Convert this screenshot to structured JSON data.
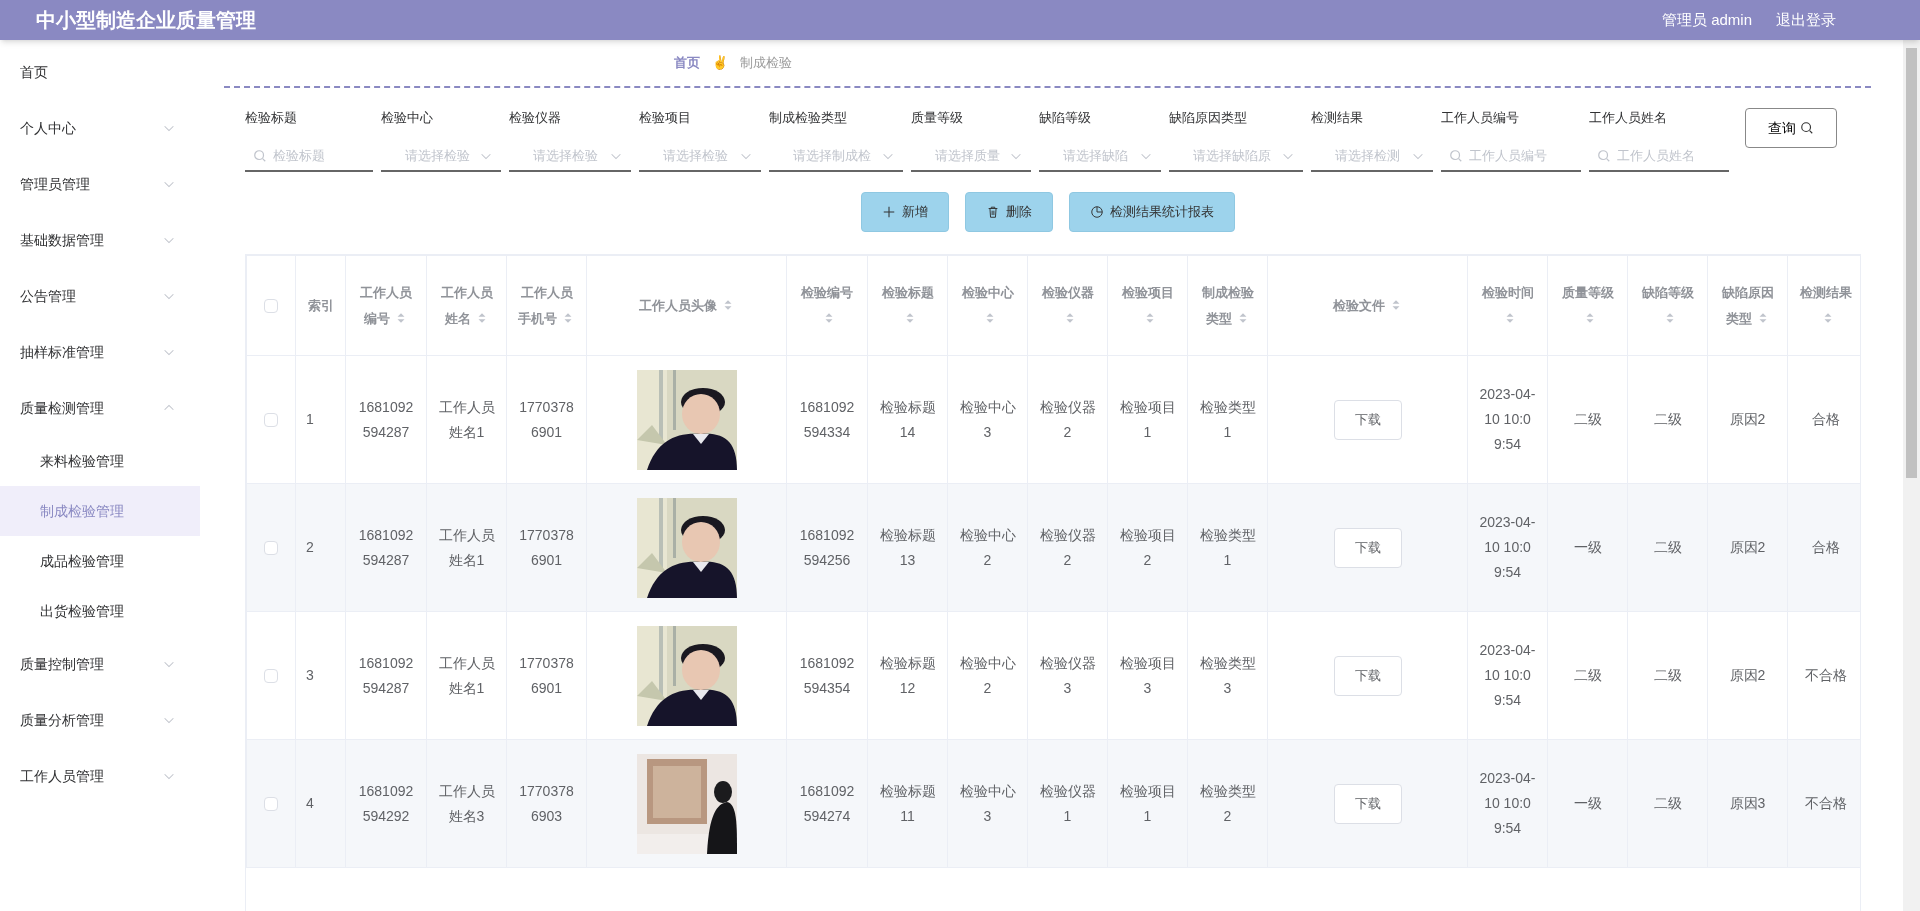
{
  "header": {
    "title": "中小型制造企业质量管理",
    "user": "管理员 admin",
    "logout": "退出登录"
  },
  "sidebar": {
    "items": [
      {
        "label": "首页",
        "kind": "link",
        "selected": false
      },
      {
        "label": "个人中心",
        "kind": "menu",
        "expanded": false,
        "selected": false
      },
      {
        "label": "管理员管理",
        "kind": "menu",
        "expanded": false,
        "selected": false
      },
      {
        "label": "基础数据管理",
        "kind": "menu",
        "expanded": false,
        "selected": false
      },
      {
        "label": "公告管理",
        "kind": "menu",
        "expanded": false,
        "selected": false
      },
      {
        "label": "抽样标准管理",
        "kind": "menu",
        "expanded": false,
        "selected": false
      },
      {
        "label": "质量检测管理",
        "kind": "menu",
        "expanded": true,
        "selected": false,
        "children": [
          {
            "label": "来料检验管理",
            "selected": false
          },
          {
            "label": "制成检验管理",
            "selected": true
          },
          {
            "label": "成品检验管理",
            "selected": false
          },
          {
            "label": "出货检验管理",
            "selected": false
          }
        ]
      },
      {
        "label": "质量控制管理",
        "kind": "menu",
        "expanded": false,
        "selected": false
      },
      {
        "label": "质量分析管理",
        "kind": "menu",
        "expanded": false,
        "selected": false
      },
      {
        "label": "工作人员管理",
        "kind": "menu",
        "expanded": false,
        "selected": false
      }
    ]
  },
  "breadcrumb": {
    "home": "首页",
    "separator": "✌",
    "current": "制成检验"
  },
  "filters": [
    {
      "label": "检验标题",
      "kind": "search",
      "placeholder": "检验标题"
    },
    {
      "label": "检验中心",
      "kind": "select",
      "placeholder": "请选择检验"
    },
    {
      "label": "检验仪器",
      "kind": "select",
      "placeholder": "请选择检验"
    },
    {
      "label": "检验项目",
      "kind": "select",
      "placeholder": "请选择检验"
    },
    {
      "label": "制成检验类型",
      "kind": "select",
      "placeholder": "请选择制成检"
    },
    {
      "label": "质量等级",
      "kind": "select",
      "placeholder": "请选择质量"
    },
    {
      "label": "缺陷等级",
      "kind": "select",
      "placeholder": "请选择缺陷"
    },
    {
      "label": "缺陷原因类型",
      "kind": "select",
      "placeholder": "请选择缺陷原"
    },
    {
      "label": "检测结果",
      "kind": "select",
      "placeholder": "请选择检测"
    },
    {
      "label": "工作人员编号",
      "kind": "search",
      "placeholder": "工作人员编号"
    },
    {
      "label": "工作人员姓名",
      "kind": "search",
      "placeholder": "工作人员姓名"
    }
  ],
  "query_button": "查询",
  "actions": [
    {
      "label": "新增",
      "kind": "add"
    },
    {
      "label": "删除",
      "kind": "delete"
    },
    {
      "label": "检测结果统计报表",
      "kind": "chart"
    }
  ],
  "table": {
    "select_all": {
      "checked": false
    },
    "columns": [
      {
        "label": "索引",
        "kind": "index",
        "sortable": false
      },
      {
        "label": "工作人员编号",
        "kind": "text",
        "sortable": true
      },
      {
        "label": "工作人员姓名",
        "kind": "text",
        "sortable": true
      },
      {
        "label": "工作人员手机号",
        "kind": "text",
        "sortable": true
      },
      {
        "label": "工作人员头像",
        "sortable": true
      },
      {
        "label": "检验编号",
        "kind": "text",
        "sortable": true
      },
      {
        "label": "检验标题",
        "kind": "text",
        "sortable": true
      },
      {
        "label": "检验中心",
        "kind": "text",
        "sortable": true
      },
      {
        "label": "检验仪器",
        "kind": "text",
        "sortable": true
      },
      {
        "label": "检验项目",
        "kind": "text",
        "sortable": true
      },
      {
        "label": "制成检验类型",
        "kind": "text",
        "sortable": true
      },
      {
        "label": "检验文件",
        "kind": "file",
        "sortable": true
      },
      {
        "label": "检验时间",
        "kind": "text",
        "sortable": true
      },
      {
        "label": "质量等级",
        "kind": "text",
        "sortable": true
      },
      {
        "label": "缺陷等级",
        "kind": "text",
        "sortable": true
      },
      {
        "label": "缺陷原因类型",
        "kind": "text",
        "sortable": true
      },
      {
        "label": "检测结果",
        "kind": "text",
        "sortable": true
      }
    ],
    "rows": [
      {
        "checked": false,
        "cells": [
          "1",
          "1681092594287",
          "工作人员姓名1",
          "17703786901",
          {
            "kind": "picture"
          },
          "1681092594334",
          "检验标题14",
          "检验中心3",
          "检验仪器2",
          "检验项目1",
          "检验类型1",
          "下载",
          "2023-04-10 10:09:54",
          "二级",
          "二级",
          "原因2",
          "合格"
        ]
      },
      {
        "checked": false,
        "cells": [
          "2",
          "1681092594287",
          "工作人员姓名1",
          "17703786901",
          {
            "kind": "picture"
          },
          "1681092594256",
          "检验标题13",
          "检验中心2",
          "检验仪器2",
          "检验项目2",
          "检验类型1",
          "下载",
          "2023-04-10 10:09:54",
          "一级",
          "二级",
          "原因2",
          "合格"
        ]
      },
      {
        "checked": false,
        "cells": [
          "3",
          "1681092594287",
          "工作人员姓名1",
          "17703786901",
          {
            "kind": "picture"
          },
          "1681092594354",
          "检验标题12",
          "检验中心2",
          "检验仪器3",
          "检验项目3",
          "检验类型3",
          "下载",
          "2023-04-10 10:09:54",
          "二级",
          "二级",
          "原因2",
          "不合格"
        ]
      },
      {
        "checked": false,
        "cells": [
          "4",
          "1681092594292",
          "工作人员姓名3",
          "17703786903",
          {
            "kind": "picture"
          },
          "1681092594274",
          "检验标题11",
          "检验中心3",
          "检验仪器1",
          "检验项目1",
          "检验类型2",
          "下载",
          "2023-04-10 10:09:54",
          "一级",
          "二级",
          "原因3",
          "不合格"
        ]
      }
    ]
  }
}
